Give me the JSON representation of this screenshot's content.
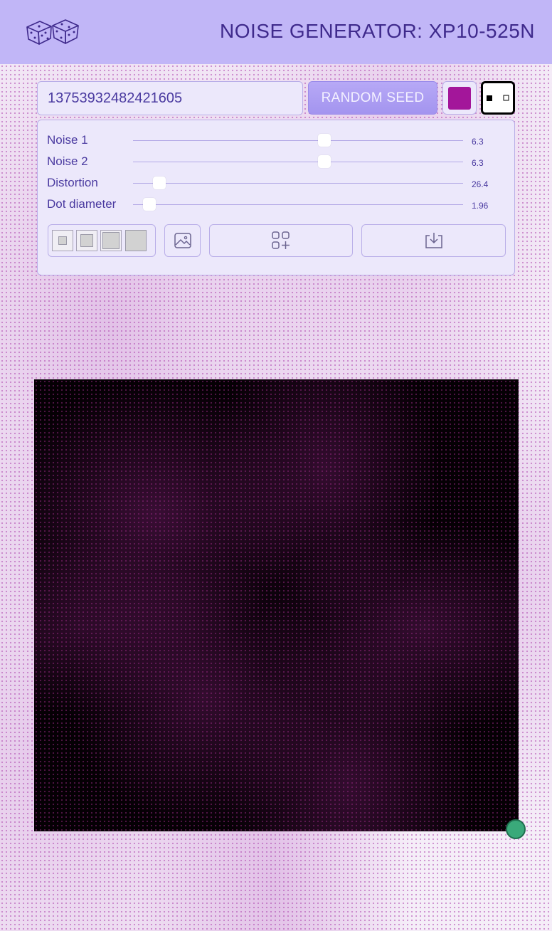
{
  "header": {
    "title": "NOISE GENERATOR: XP10-525N",
    "logo_icon": "dice-icon"
  },
  "controls": {
    "seed_value": "13753932482421605",
    "random_seed_label": "RANDOM SEED",
    "dot_color": "#a3169a",
    "mode_icon": "invert-colors-icon"
  },
  "sliders": [
    {
      "label": "Noise 1",
      "value": "6.3",
      "fraction": 0.58
    },
    {
      "label": "Noise 2",
      "value": "6.3",
      "fraction": 0.58
    },
    {
      "label": "Distortion",
      "value": "26.4",
      "fraction": 0.08
    },
    {
      "label": "Dot diameter",
      "value": "1.96",
      "fraction": 0.05
    }
  ],
  "toolbar": {
    "size_options": [
      "size-small",
      "size-medium",
      "size-large",
      "size-xlarge"
    ],
    "background_image_icon": "image-icon",
    "add_icon": "add-grid-icon",
    "download_icon": "download-icon"
  },
  "canvas": {
    "background_color": "#050004"
  }
}
